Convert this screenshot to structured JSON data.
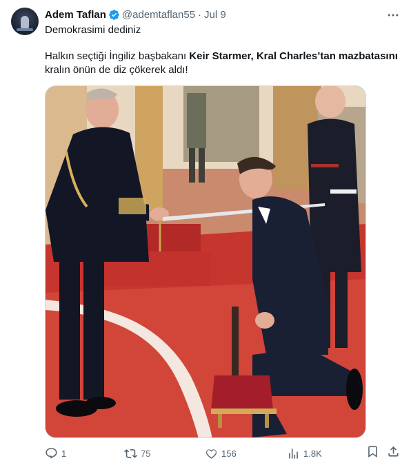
{
  "tweet": {
    "author_name": "Adem Taflan",
    "author_handle": "@ademtaflan55",
    "separator": "·",
    "date": "Jul 9",
    "text_line1": "Demokrasimi dediniz",
    "body_part1": "Halkın seçtiği İngiliz başbakanı ",
    "body_bold": "Keir Starmer, Kral Charles’tan mazbatasını",
    "body_part2": " kralın önün de diz çökerek  aldı!"
  },
  "actions": {
    "reply_count": "1",
    "retweet_count": "75",
    "like_count": "156",
    "view_count": "1.8K"
  },
  "icons": {
    "avatar": "user-avatar",
    "verified": "verified-badge-icon",
    "more": "more-dots-icon",
    "reply": "reply-icon",
    "retweet": "retweet-icon",
    "like": "heart-icon",
    "views": "views-icon",
    "bookmark": "bookmark-icon",
    "share": "share-icon"
  },
  "colors": {
    "text": "#0f1419",
    "secondary": "#536471",
    "verified": "#1d9bf0",
    "border": "#cfd9de"
  }
}
